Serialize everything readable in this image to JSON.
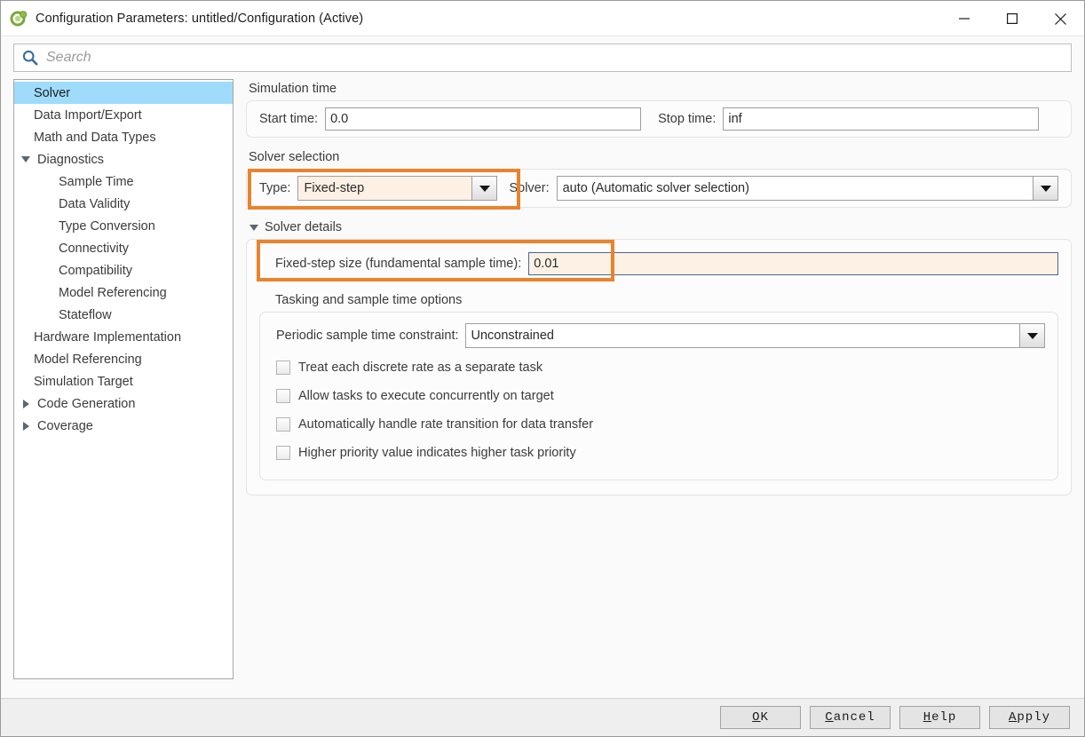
{
  "window": {
    "title": "Configuration Parameters: untitled/Configuration (Active)",
    "app_icon": "simulink-icon",
    "minimize": "–",
    "maximize": "□",
    "close": "✕"
  },
  "search": {
    "placeholder": "Search",
    "value": "",
    "icon": "search-icon"
  },
  "tree": {
    "items": [
      {
        "label": "Solver",
        "level": 0,
        "selected": true,
        "arrow": "none"
      },
      {
        "label": "Data Import/Export",
        "level": 0,
        "selected": false,
        "arrow": "none"
      },
      {
        "label": "Math and Data Types",
        "level": 0,
        "selected": false,
        "arrow": "none"
      },
      {
        "label": "Diagnostics",
        "level": 0,
        "selected": false,
        "arrow": "down"
      },
      {
        "label": "Sample Time",
        "level": 1,
        "selected": false,
        "arrow": "none"
      },
      {
        "label": "Data Validity",
        "level": 1,
        "selected": false,
        "arrow": "none"
      },
      {
        "label": "Type Conversion",
        "level": 1,
        "selected": false,
        "arrow": "none"
      },
      {
        "label": "Connectivity",
        "level": 1,
        "selected": false,
        "arrow": "none"
      },
      {
        "label": "Compatibility",
        "level": 1,
        "selected": false,
        "arrow": "none"
      },
      {
        "label": "Model Referencing",
        "level": 1,
        "selected": false,
        "arrow": "none"
      },
      {
        "label": "Stateflow",
        "level": 1,
        "selected": false,
        "arrow": "none"
      },
      {
        "label": "Hardware Implementation",
        "level": 0,
        "selected": false,
        "arrow": "none"
      },
      {
        "label": "Model Referencing",
        "level": 0,
        "selected": false,
        "arrow": "none"
      },
      {
        "label": "Simulation Target",
        "level": 0,
        "selected": false,
        "arrow": "none"
      },
      {
        "label": "Code Generation",
        "level": 0,
        "selected": false,
        "arrow": "right"
      },
      {
        "label": "Coverage",
        "level": 0,
        "selected": false,
        "arrow": "right"
      }
    ]
  },
  "pane": {
    "simulation_time": {
      "heading": "Simulation time",
      "start_label": "Start time:",
      "start_value": "0.0",
      "stop_label": "Stop time:",
      "stop_value": "inf"
    },
    "solver_selection": {
      "heading": "Solver selection",
      "type_label": "Type:",
      "type_value": "Fixed-step",
      "solver_label": "Solver:",
      "solver_value": "auto (Automatic solver selection)"
    },
    "solver_details": {
      "heading": "Solver details",
      "fixed_step_label": "Fixed-step size (fundamental sample time):",
      "fixed_step_value": "0.01"
    },
    "tasking": {
      "heading": "Tasking and sample time options",
      "constraint_label": "Periodic sample time constraint:",
      "constraint_value": "Unconstrained",
      "checkboxes": [
        {
          "label": "Treat each discrete rate as a separate task",
          "checked": false
        },
        {
          "label": "Allow tasks to execute concurrently on target",
          "checked": false
        },
        {
          "label": "Automatically handle rate transition for data transfer",
          "checked": false
        },
        {
          "label": "Higher priority value indicates higher task priority",
          "checked": false
        }
      ]
    }
  },
  "footer": {
    "ok": {
      "mnemonic": "O",
      "rest": "K"
    },
    "cancel": {
      "mnemonic": "C",
      "rest": "ancel"
    },
    "help": {
      "mnemonic": "H",
      "rest": "elp"
    },
    "apply": {
      "mnemonic": "A",
      "rest": "pply"
    }
  },
  "colors": {
    "highlight_orange": "#e9832c",
    "selection_blue": "#9fdcfb",
    "field_peach": "#fcf1e4",
    "field_focus_border": "#4a6591"
  }
}
